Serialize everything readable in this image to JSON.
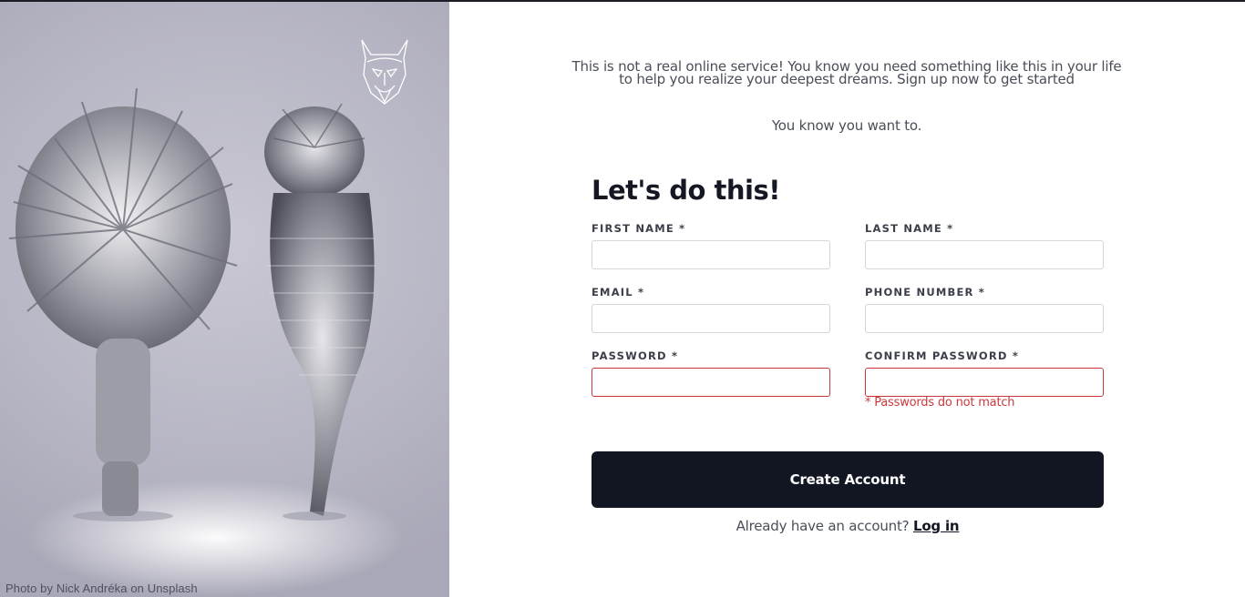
{
  "hero": {
    "credit": "Photo by Nick Andréka on Unsplash",
    "logo_icon": "viking-helmet-logo-icon"
  },
  "intro": {
    "line1": "This is not a real online service! You know you need something like this in your life",
    "line2": "to help you realize your deepest dreams. Sign up now to get started",
    "tagline": "You know you want to."
  },
  "form": {
    "title": "Let's do this!",
    "first_name": {
      "label": "FIRST NAME *",
      "value": ""
    },
    "last_name": {
      "label": "LAST NAME *",
      "value": ""
    },
    "email": {
      "label": "EMAIL *",
      "value": ""
    },
    "phone": {
      "label": "PHONE NUMBER *",
      "value": ""
    },
    "password": {
      "label": "PASSWORD *",
      "value": ""
    },
    "confirm_password": {
      "label": "CONFIRM PASSWORD *",
      "value": ""
    },
    "error": "* Passwords do not match",
    "submit_label": "Create Account",
    "login_prompt": "Already have an account?",
    "login_link": "Log in"
  },
  "colors": {
    "primary": "#121623",
    "error": "#c9393c",
    "text": "#4a4e58"
  }
}
